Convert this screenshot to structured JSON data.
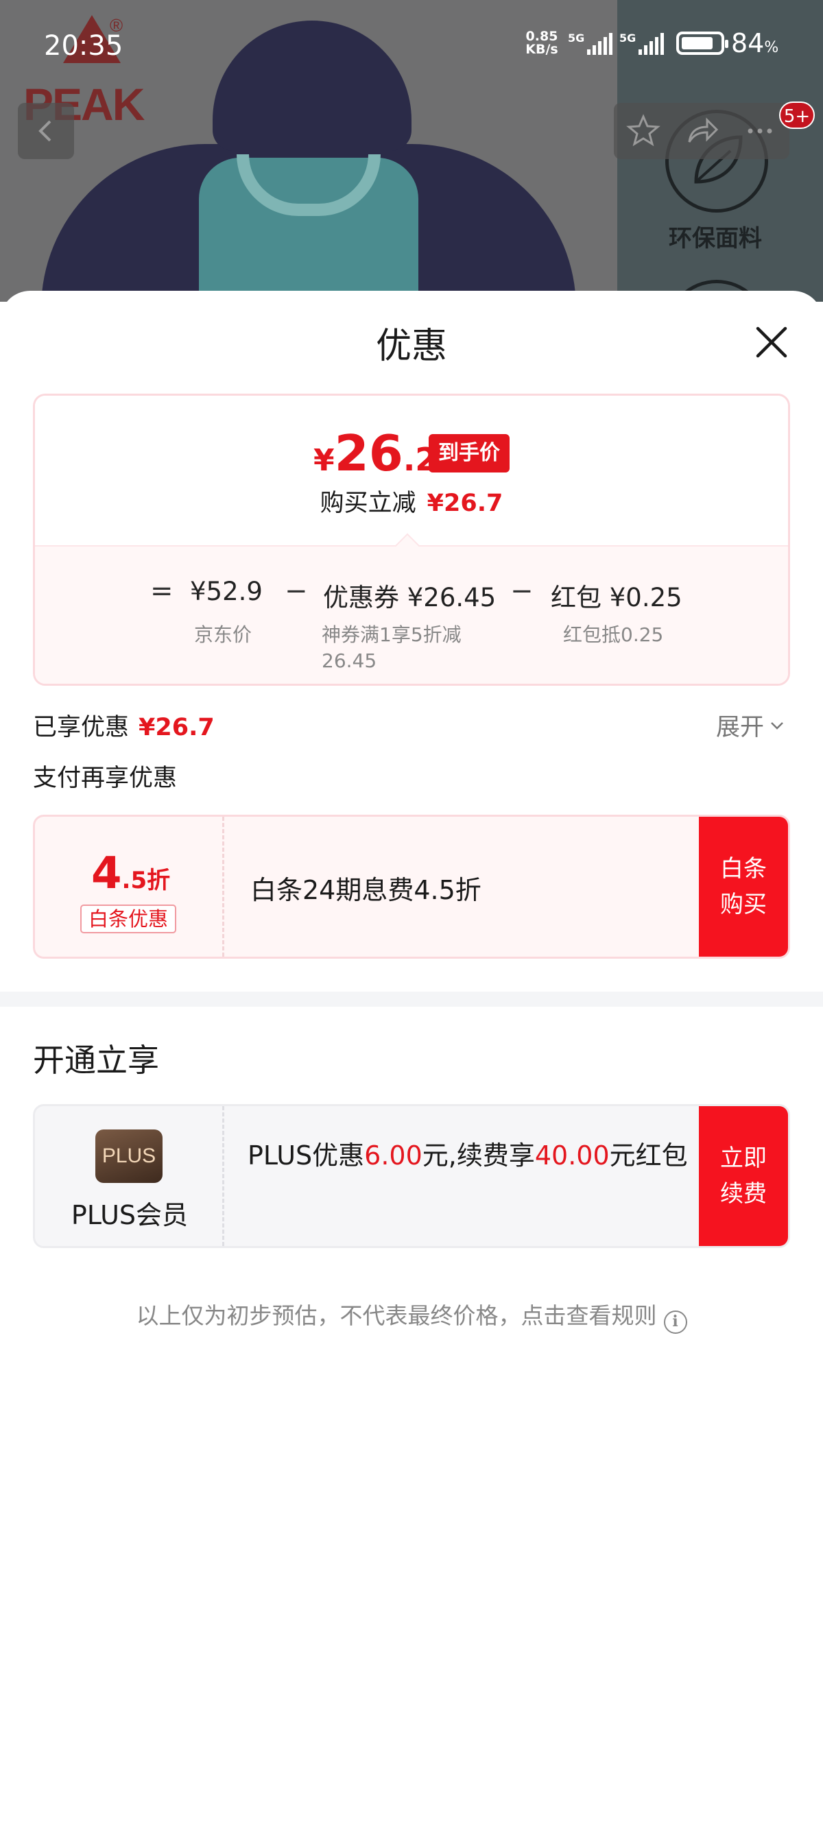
{
  "status_bar": {
    "time": "20:35",
    "net_speed_value": "0.85",
    "net_speed_unit": "KB/s",
    "sim1": "5G",
    "sim2": "5G",
    "battery_pct": "84",
    "battery_unit": "%",
    "battery_level": 0.84
  },
  "background": {
    "brand_logo": "PEAK",
    "brand_logo_mark": "®",
    "feature_label": "环保面料"
  },
  "nav": {
    "notification_badge": "5+"
  },
  "sheet": {
    "title": "优惠"
  },
  "price_card": {
    "final_price_symbol": "¥",
    "final_price_int": "26",
    "final_price_dec": ".2",
    "final_price_tag": "到手价",
    "reduce_label": "购买立减",
    "reduce_amount": "¥26.7",
    "breakdown": {
      "eq": "=",
      "jd_price": "¥52.9",
      "jd_label": "京东价",
      "minus1": "−",
      "coupon": "优惠券 ¥26.45",
      "coupon_desc_line1": "神券满1享5折减",
      "coupon_desc_line2": "26.45",
      "minus2": "−",
      "redpacket": "红包 ¥0.25",
      "redpacket_desc": "红包抵0.25"
    }
  },
  "enjoyed": {
    "label": "已享优惠",
    "amount": "¥26.7",
    "expand_label": "展开"
  },
  "pay_more": {
    "label": "支付再享优惠"
  },
  "baitiao": {
    "discount_big": "4",
    "discount_small": ".5折",
    "tag": "白条优惠",
    "text": "白条24期息费4.5折",
    "button_line1": "白条",
    "button_line2": "购买"
  },
  "kaitong": {
    "title": "开通立享"
  },
  "plus": {
    "logo_text": "PLUS",
    "name": "PLUS会员",
    "text_a": "PLUS优惠",
    "amount1": "6.00",
    "text_b": "元,续费享",
    "amount2": "40.00",
    "text_c": "元红包",
    "button_line1": "立即",
    "button_line2": "续费"
  },
  "footnote": {
    "text": "以上仅为初步预估，不代表最终价格，点击查看规则",
    "info_icon": "i"
  },
  "colors": {
    "accent_red": "#e4161e",
    "button_red": "#f5131f",
    "card_border_pink": "#fbd9dd",
    "overlay_gray": "#6f6f70"
  }
}
